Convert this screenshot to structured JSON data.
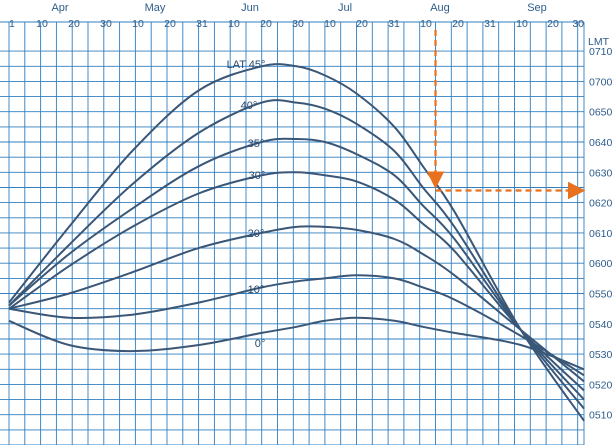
{
  "chart_data": {
    "type": "line",
    "title": "",
    "xlabel": "",
    "ylabel": "",
    "y_unit_label": "LMT",
    "month_labels": [
      "Apr",
      "May",
      "Jun",
      "Jul",
      "Aug",
      "Sep"
    ],
    "x_tick_labels": [
      "1",
      "10",
      "20",
      "30",
      "10",
      "20",
      "31",
      "10",
      "20",
      "30",
      "10",
      "20",
      "31",
      "10",
      "20",
      "31",
      "10",
      "20",
      "30"
    ],
    "y_tick_labels": [
      "0710",
      "0700",
      "0650",
      "0640",
      "0630",
      "0620",
      "0610",
      "0600",
      "0550",
      "0540",
      "0530",
      "0520",
      "0510"
    ],
    "x_range": [
      "Apr 1",
      "Sep 30"
    ],
    "y_range_minutes": [
      300,
      434
    ],
    "grid": true,
    "colors": {
      "line": "#3a5778",
      "grid": "#2f7fc1",
      "text": "#2e5c8a",
      "example": "#e8711f"
    },
    "series": [
      {
        "name": "LAT 45°",
        "x": [
          "Apr 1",
          "Apr 20",
          "May 10",
          "May 31",
          "Jun 20",
          "Jul 1",
          "Jul 10",
          "Jul 20",
          "Aug 1",
          "Aug 10",
          "Aug 20",
          "Sep 10",
          "Sep 30"
        ],
        "y": [
          "05:47",
          "06:12",
          "06:37",
          "06:57",
          "07:05",
          "07:05",
          "07:02",
          "06:56",
          "06:45",
          "06:32",
          "06:17",
          "05:38",
          "05:08"
        ]
      },
      {
        "name": "40°",
        "x": [
          "Apr 1",
          "Apr 20",
          "May 10",
          "May 31",
          "Jun 20",
          "Jul 1",
          "Jul 10",
          "Jul 20",
          "Aug 1",
          "Aug 10",
          "Aug 20",
          "Sep 10",
          "Sep 30"
        ],
        "y": [
          "05:46",
          "06:06",
          "06:26",
          "06:43",
          "06:53",
          "06:53",
          "06:51",
          "06:46",
          "06:37",
          "06:25",
          "06:12",
          "05:38",
          "05:12"
        ]
      },
      {
        "name": "35°",
        "x": [
          "Apr 1",
          "Apr 20",
          "May 10",
          "May 31",
          "Jun 20",
          "Jul 1",
          "Jul 10",
          "Jul 20",
          "Aug 1",
          "Aug 10",
          "Aug 20",
          "Sep 10",
          "Sep 30"
        ],
        "y": [
          "05:46",
          "06:03",
          "06:18",
          "06:32",
          "06:40",
          "06:41",
          "06:40",
          "06:36",
          "06:29",
          "06:19",
          "06:08",
          "05:38",
          "05:15"
        ]
      },
      {
        "name": "30°",
        "x": [
          "Apr 1",
          "Apr 20",
          "May 10",
          "May 31",
          "Jun 20",
          "Jul 1",
          "Jul 10",
          "Jul 20",
          "Aug 1",
          "Aug 10",
          "Aug 20",
          "Sep 10",
          "Sep 30"
        ],
        "y": [
          "05:45",
          "05:59",
          "06:12",
          "06:23",
          "06:29",
          "06:30",
          "06:29",
          "06:27",
          "06:21",
          "06:13",
          "06:04",
          "05:38",
          "05:18"
        ]
      },
      {
        "name": "20°",
        "x": [
          "Apr 1",
          "Apr 20",
          "May 10",
          "May 31",
          "Jun 20",
          "Jul 1",
          "Jul 10",
          "Jul 20",
          "Aug 1",
          "Aug 10",
          "Aug 20",
          "Sep 10",
          "Sep 30"
        ],
        "y": [
          "05:45",
          "05:50",
          "05:57",
          "06:05",
          "06:10",
          "06:12",
          "06:12",
          "06:11",
          "06:08",
          "06:03",
          "05:56",
          "05:38",
          "05:21"
        ]
      },
      {
        "name": "10°",
        "x": [
          "Apr 1",
          "Apr 20",
          "May 10",
          "May 31",
          "Jun 20",
          "Jul 1",
          "Jul 10",
          "Jul 20",
          "Aug 1",
          "Aug 10",
          "Aug 20",
          "Sep 10",
          "Sep 30"
        ],
        "y": [
          "05:45",
          "05:42",
          "05:43",
          "05:47",
          "05:52",
          "05:54",
          "05:55",
          "05:56",
          "05:55",
          "05:52",
          "05:48",
          "05:36",
          "05:23"
        ]
      },
      {
        "name": "0°",
        "x": [
          "Apr 1",
          "Apr 20",
          "May 10",
          "May 31",
          "Jun 20",
          "Jul 1",
          "Jul 10",
          "Jul 20",
          "Aug 1",
          "Aug 10",
          "Aug 20",
          "Sep 10",
          "Sep 30"
        ],
        "y": [
          "05:41",
          "05:33",
          "05:31",
          "05:33",
          "05:37",
          "05:39",
          "05:41",
          "05:42",
          "05:41",
          "05:39",
          "05:37",
          "05:33",
          "05:25"
        ]
      }
    ],
    "annotations": [
      {
        "style": "dashed-arrows",
        "from_x": "Aug 14",
        "to_value": "06:24"
      }
    ]
  }
}
